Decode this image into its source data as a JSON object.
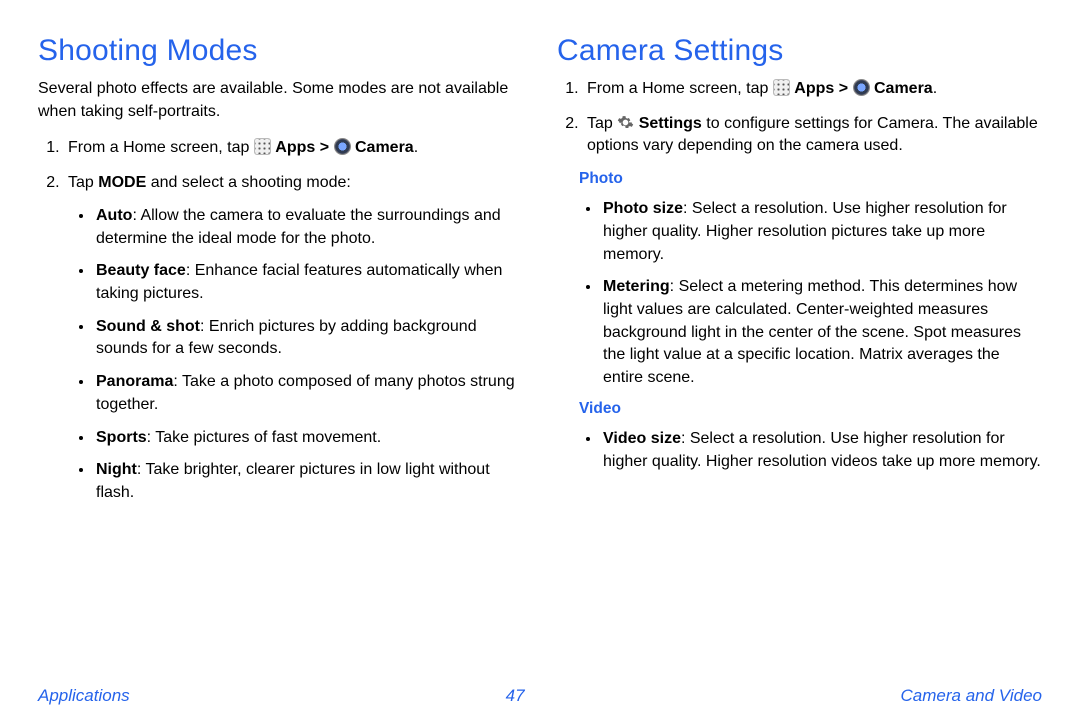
{
  "left": {
    "title": "Shooting Modes",
    "intro": "Several photo effects are available. Some modes are not available when taking self-portraits.",
    "step1_a": "From a Home screen, tap ",
    "step1_apps": "Apps > ",
    "step1_camera": "Camera",
    "step1_end": ".",
    "step2_a": "Tap ",
    "step2_mode": "MODE",
    "step2_b": " and select a shooting mode:",
    "modes": [
      {
        "name": "Auto",
        "desc": ": Allow the camera to evaluate the surroundings and determine the ideal mode for the photo."
      },
      {
        "name": "Beauty face",
        "desc": ": Enhance facial features automatically when taking pictures."
      },
      {
        "name": "Sound & shot",
        "desc": ": Enrich pictures by adding background sounds for a few seconds."
      },
      {
        "name": "Panorama",
        "desc": ": Take a photo composed of many photos strung together."
      },
      {
        "name": "Sports",
        "desc": ": Take pictures of fast movement."
      },
      {
        "name": "Night",
        "desc": ": Take brighter, clearer pictures in low light without flash."
      }
    ]
  },
  "right": {
    "title": "Camera Settings",
    "step1_a": "From a Home screen, tap ",
    "step1_apps": "Apps > ",
    "step1_camera": "Camera",
    "step1_end": ".",
    "step2_a": "Tap ",
    "step2_settings": "Settings",
    "step2_b": " to configure settings for Camera. The available options vary depending on the camera used.",
    "photo_head": "Photo",
    "photo_items": [
      {
        "name": "Photo size",
        "desc": ": Select a resolution. Use higher resolution for higher quality. Higher resolution pictures take up more memory."
      },
      {
        "name": "Metering",
        "desc": ": Select a metering method. This determines how light values are calculated. Center-weighted measures background light in the center of the scene. Spot measures the light value at a specific location. Matrix averages the entire scene."
      }
    ],
    "video_head": "Video",
    "video_items": [
      {
        "name": "Video size",
        "desc": ": Select a resolution. Use higher resolution for higher quality. Higher resolution videos take up more memory."
      }
    ]
  },
  "footer": {
    "left": "Applications",
    "center": "47",
    "right": "Camera and Video"
  }
}
